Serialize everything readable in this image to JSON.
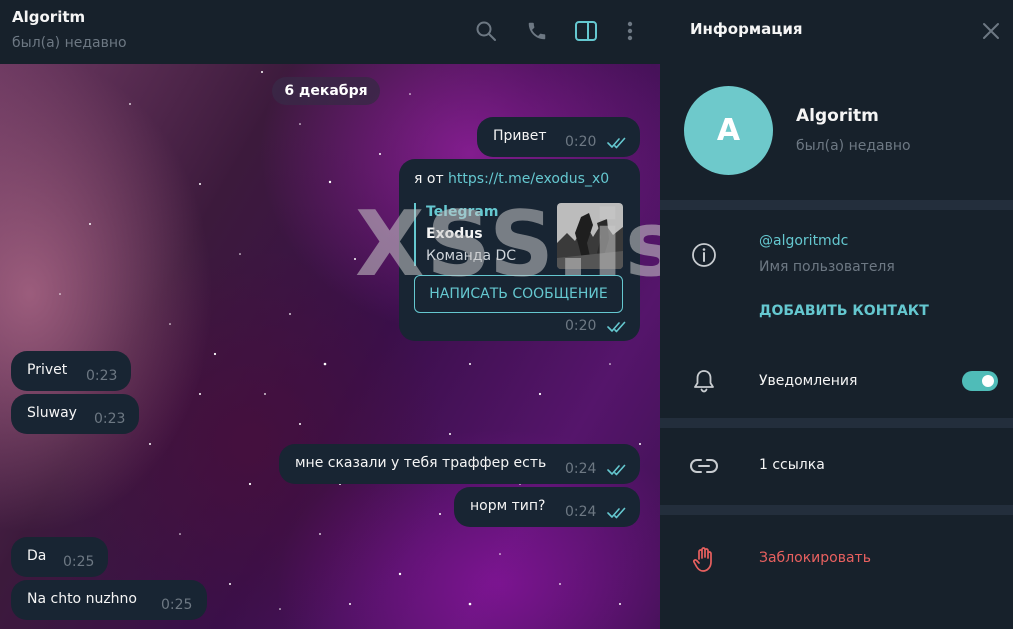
{
  "chat": {
    "title": "Algoritm",
    "status": "был(а) недавно",
    "date_separator": "6 декабря",
    "watermark": "XSS.is"
  },
  "header_icons": [
    "search-icon",
    "phone-icon",
    "sidebar-toggle-icon",
    "more-vertical-icon"
  ],
  "messages": [
    {
      "dir": "out",
      "text": "Привет",
      "time": "0:20"
    },
    {
      "dir": "out",
      "text_prefix": "я от ",
      "link": "https://t.me/exodus_x0",
      "time": "0:20",
      "preview": {
        "site": "Telegram",
        "title": "Exodus",
        "description": "Команда DC",
        "button": "НАПИСАТЬ СООБЩЕНИЕ"
      }
    },
    {
      "dir": "in",
      "text": "Privet",
      "time": "0:23"
    },
    {
      "dir": "in",
      "text": "Sluway",
      "time": "0:23"
    },
    {
      "dir": "out",
      "text": "мне сказали у тебя траффер есть",
      "time": "0:24"
    },
    {
      "dir": "out",
      "text": "норм тип?",
      "time": "0:24"
    },
    {
      "dir": "in",
      "text": "Da",
      "time": "0:25"
    },
    {
      "dir": "in",
      "text": "Na chto nuzhno",
      "time": "0:25"
    }
  ],
  "info": {
    "title": "Информация",
    "avatar_letter": "A",
    "name": "Algoritm",
    "status": "был(а) недавно",
    "username": "@algoritmdc",
    "username_label": "Имя пользователя",
    "add_contact": "ДОБАВИТЬ КОНТАКТ",
    "notifications": "Уведомления",
    "notifications_on": true,
    "links": "1 ссылка",
    "block": "Заблокировать"
  },
  "colors": {
    "accent": "#65c8d0",
    "danger": "#e8605f",
    "panel": "#17212b",
    "bubble": "#182533",
    "avatar": "#6ec9cb"
  }
}
